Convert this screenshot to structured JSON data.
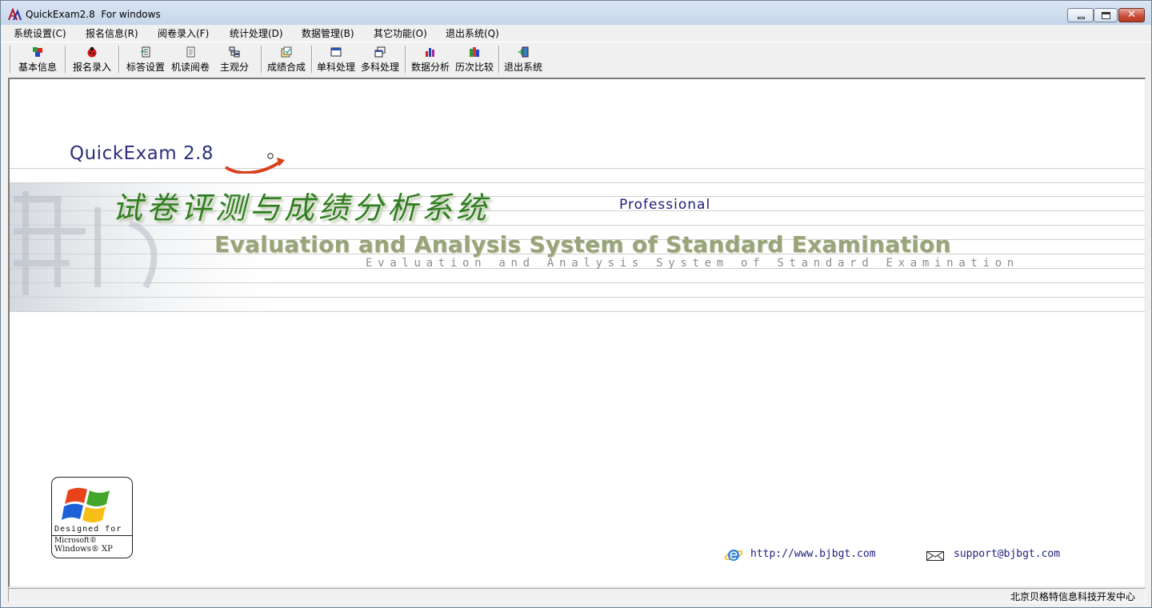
{
  "window": {
    "title": "QuickExam2.8  For windows",
    "minimize_label": "minimize",
    "maximize_label": "restore",
    "close_glyph": "✕"
  },
  "menu": [
    "系统设置(C)",
    "报名信息(R)",
    "阅卷录入(F)",
    "统计处理(D)",
    "数据管理(B)",
    "其它功能(O)",
    "退出系统(Q)"
  ],
  "toolbar": [
    {
      "label": "基本信息",
      "icon": "cube-stack-icon"
    },
    {
      "label": "报名录入",
      "icon": "ladybug-icon"
    },
    {
      "label": "标答设置",
      "icon": "checklist-icon"
    },
    {
      "label": "机读阅卷",
      "icon": "document-icon"
    },
    {
      "label": "主观分",
      "icon": "tree-structure-icon"
    },
    {
      "label": "成绩合成",
      "icon": "merge-icon"
    },
    {
      "label": "单科处理",
      "icon": "window-icon"
    },
    {
      "label": "多科处理",
      "icon": "multi-window-icon"
    },
    {
      "label": "数据分析",
      "icon": "bar-chart-icon"
    },
    {
      "label": "历次比较",
      "icon": "books-icon"
    },
    {
      "label": "退出系统",
      "icon": "exit-door-icon"
    }
  ],
  "splash": {
    "product_name": "QuickExam 2.8",
    "registered_mark": "®",
    "chinese_title": "试卷评测与成绩分析系统",
    "edition": "Professional",
    "english_title": "Evaluation and Analysis System of Standard Examination",
    "english_subtitle": "Evaluation and Analysis System of Standard Examination",
    "badge": {
      "line1": "Designed for",
      "line2": "Microsoft®",
      "line3": "Windows® XP"
    },
    "website": "http://www.bjbgt.com",
    "email": "support@bjbgt.com"
  },
  "status": {
    "text": "北京贝格特信息科技开发中心"
  },
  "colors": {
    "title_navy": "#1b1d7a",
    "chinese_title_green": "#2f7f1f",
    "english_title_olive": "#9aa47a",
    "close_red": "#c64a34"
  }
}
